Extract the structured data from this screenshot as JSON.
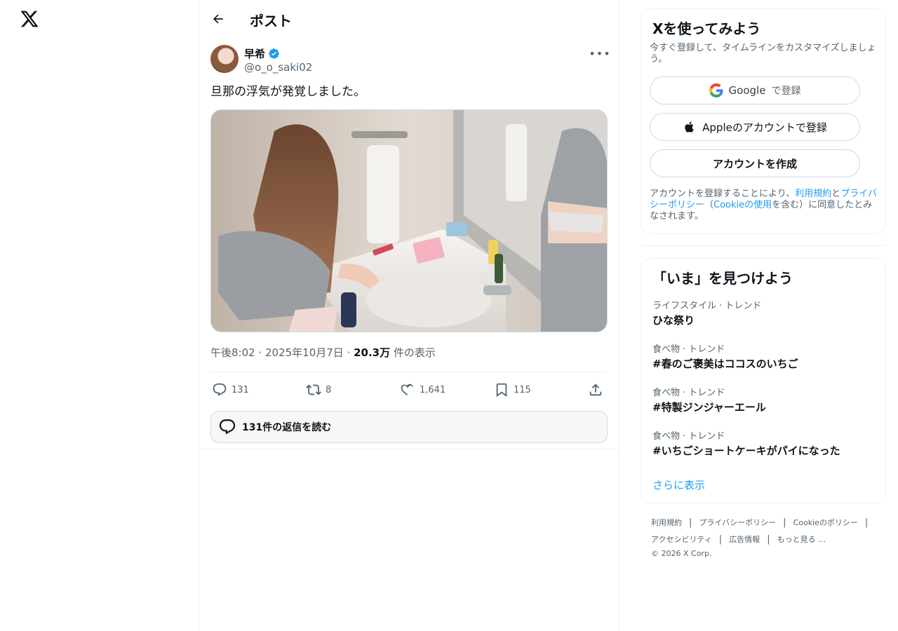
{
  "header": {
    "title": "ポスト"
  },
  "post": {
    "author_name": "早希",
    "author_handle": "@o_o_saki02",
    "text": "旦那の浮気が発覚しました。",
    "meta_time": "午後8:02 · 2025年10月7日 · ",
    "meta_views": "20.3万",
    "meta_views_suffix": " 件の表示",
    "actions": {
      "replies": "131",
      "reposts": "8",
      "likes": "1,641",
      "bookmarks": "115"
    },
    "read_replies": "131件の返信を読む"
  },
  "signup": {
    "title": "Xを使ってみよう",
    "subtitle": "今すぐ登録して、タイムラインをカスタマイズしましょう。",
    "google_label": "Google",
    "google_suffix": "で登録",
    "apple_label": "Appleのアカウントで登録",
    "create_label": "アカウントを作成",
    "terms_prefix": "アカウントを登録することにより、",
    "terms_link": "利用規約",
    "terms_and": "と",
    "privacy_link": "プライバシーポリシー",
    "terms_open": "（",
    "cookie_link": "Cookieの使用",
    "terms_suffix": "を含む）に同意したとみなされます。"
  },
  "trends": {
    "title": "「いま」を見つけよう",
    "items": [
      {
        "category": "ライフスタイル · トレンド",
        "name": "ひな祭り"
      },
      {
        "category": "食べ物 · トレンド",
        "name": "#春のご褒美はココスのいちご"
      },
      {
        "category": "食べ物 · トレンド",
        "name": "#特製ジンジャーエール"
      },
      {
        "category": "食べ物 · トレンド",
        "name": "#いちごショートケーキがパイになった"
      }
    ],
    "show_more": "さらに表示"
  },
  "footer": {
    "links": [
      "利用規約",
      "プライバシーポリシー",
      "Cookieのポリシー",
      "アクセシビリティ",
      "広告情報",
      "もっと見る …"
    ],
    "copyright": "© 2026 X Corp."
  },
  "colors": {
    "accent": "#1d9bf0",
    "text": "#0f1419",
    "secondary": "#536471",
    "border": "#eff3f4"
  }
}
